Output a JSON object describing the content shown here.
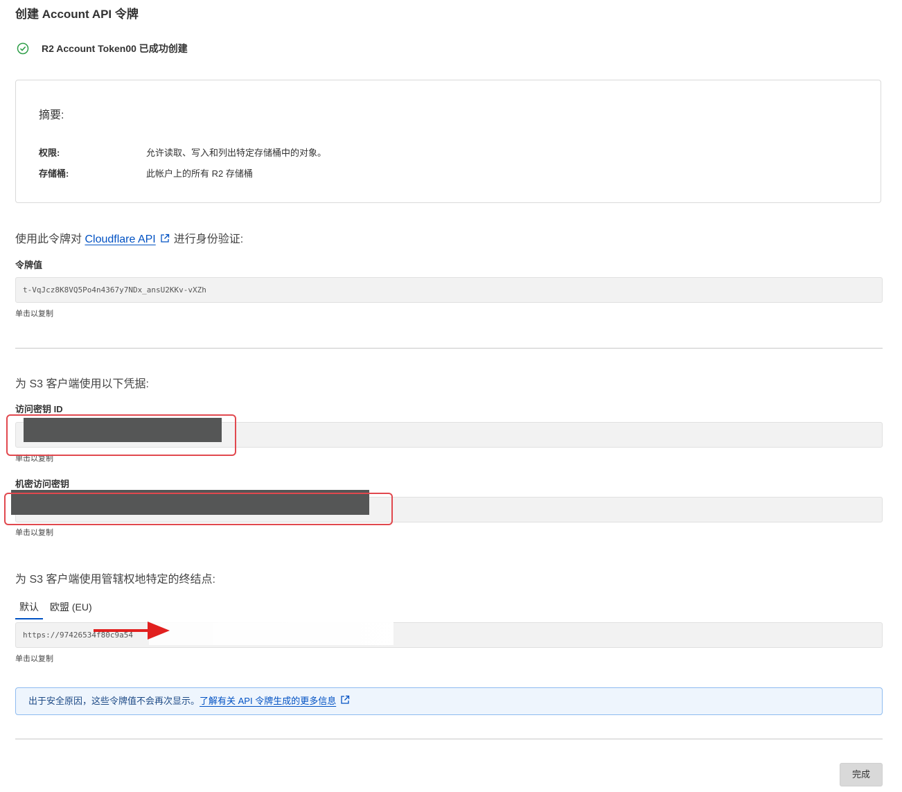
{
  "page": {
    "title": "创建 Account API 令牌",
    "success_message": "R2 Account Token00 已成功创建"
  },
  "summary": {
    "title": "摘要:",
    "rows": [
      {
        "label": "权限:",
        "value": "允许读取、写入和列出特定存储桶中的对象。"
      },
      {
        "label": "存储桶:",
        "value": "此帐户上的所有 R2 存储桶"
      }
    ]
  },
  "api_auth": {
    "prefix": "使用此令牌对",
    "link_text": "Cloudflare API",
    "suffix": "进行身份验证:",
    "token_label": "令牌值",
    "token_value": "t-VqJcz8K8VQ5Po4n4367y7NDx_ansU2KKv-vXZh",
    "copy_hint": "单击以复制"
  },
  "s3_credentials": {
    "heading": "为 S3 客户端使用以下凭据:",
    "access_key_label": "访问密钥 ID",
    "access_key_copy_hint": "单击以复制",
    "secret_key_label": "机密访问密钥",
    "secret_key_copy_hint": "单击以复制"
  },
  "endpoints": {
    "heading": "为 S3 客户端使用管辖权地特定的终结点:",
    "tabs": [
      {
        "label": "默认",
        "active": true
      },
      {
        "label": "欧盟 (EU)",
        "active": false
      }
    ],
    "endpoint_value": "https://97426534f80c9a54",
    "copy_hint": "单击以复制"
  },
  "notice": {
    "text": "出于安全原因，这些令牌值不会再次显示。",
    "link_text": "了解有关 API 令牌生成的更多信息"
  },
  "footer": {
    "done_label": "完成"
  },
  "colors": {
    "accent": "#0051c3",
    "success": "#2e9e48",
    "annotation_red": "#e1484e",
    "redaction": "#555656"
  }
}
